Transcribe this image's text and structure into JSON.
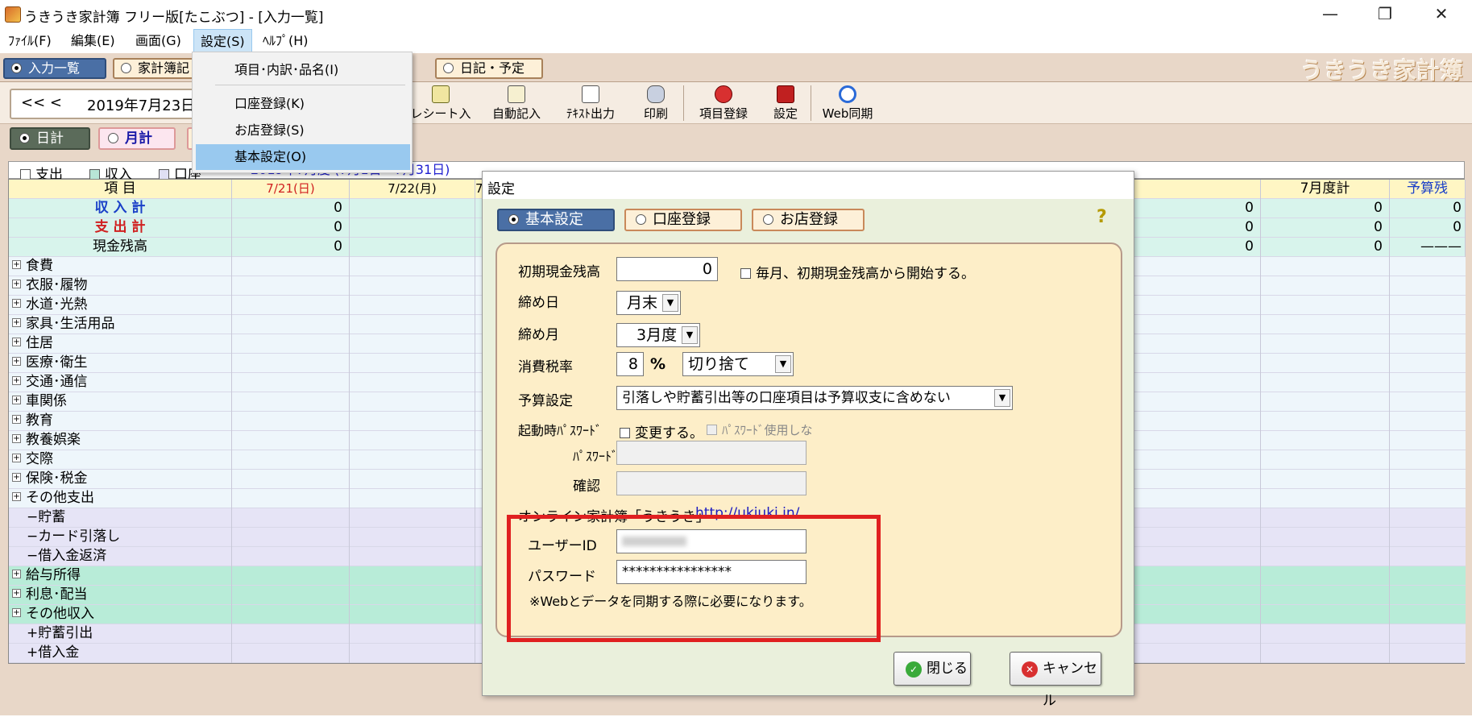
{
  "window": {
    "title": "うきうき家計簿 フリー版[たこぶつ] - [入力一覧]",
    "controls": {
      "minimize": "—",
      "maximize": "❐",
      "close": "✕"
    }
  },
  "menubar": [
    "ﾌｧｲﾙ(F)",
    "編集(E)",
    "画面(G)",
    "設定(S)",
    "ﾍﾙﾌﾟ(H)"
  ],
  "settings_menu": {
    "items": [
      "項目･内訳･品名(I)",
      "口座登録(K)",
      "お店登録(S)",
      "基本設定(O)"
    ],
    "highlighted": "基本設定(O)"
  },
  "tabs": [
    "入力一覧",
    "家計簿記",
    "日記・予定"
  ],
  "logo": "うきうき家計簿",
  "toolbar": {
    "date_nav": "<<  <",
    "date": "2019年7月23日",
    "buttons": [
      "レシート入力",
      "自動記入",
      "ﾃｷｽﾄ出力",
      "印刷",
      "項目登録",
      "設定",
      "Web同期"
    ]
  },
  "view": {
    "daily": "日計",
    "monthly": "月計"
  },
  "filters": [
    "支出",
    "収入",
    "口座"
  ],
  "filter_period": "2019年7月度 (7月1日〜7月31日)",
  "grid": {
    "headers": [
      "項 目",
      "7/21(日)",
      "7/22(月)",
      "7/2",
      "7月度計",
      "予算残"
    ],
    "summary_rows": [
      {
        "label": "収 入 計",
        "v1": "0",
        "r1": "0",
        "r2": "0",
        "r3": "0"
      },
      {
        "label": "支 出 計",
        "v1": "0",
        "r1": "0",
        "r2": "0",
        "r3": "0"
      },
      {
        "label": "現金残高",
        "v1": "0",
        "r1": "0",
        "r2": "0",
        "r3": "———"
      }
    ],
    "expense_items": [
      "食費",
      "衣服･履物",
      "水道･光熱",
      "家具･生活用品",
      "住居",
      "医療･衛生",
      "交通･通信",
      "車関係",
      "教育",
      "教養娯楽",
      "交際",
      "保険･税金",
      "その他支出"
    ],
    "transfer_out": [
      "−貯蓄",
      "−カード引落し",
      "−借入金返済"
    ],
    "income_items": [
      "給与所得",
      "利息･配当",
      "その他収入"
    ],
    "transfer_in": [
      "+貯蓄引出",
      "+借入金"
    ],
    "expand_icon": "+"
  },
  "dialog": {
    "title": "設定",
    "tabs": [
      "基本設定",
      "口座登録",
      "お店登録"
    ],
    "help_icon": "?",
    "fields": {
      "initial_cash_label": "初期現金残高",
      "initial_cash_value": "0",
      "monthly_reset_label": "毎月、初期現金残高から開始する。",
      "closing_day_label": "締め日",
      "closing_day_value": "月末",
      "closing_month_label": "締め月",
      "closing_month_value": "3月度",
      "tax_rate_label": "消費税率",
      "tax_rate_value": "8",
      "tax_unit": "%",
      "rounding_value": "切り捨て",
      "budget_label": "予算設定",
      "budget_value": "引落しや貯蓄引出等の口座項目は予算収支に含めない",
      "startup_password_label": "起動時ﾊﾟｽﾜｰﾄﾞ",
      "change_label": "変更する。",
      "no_password_label": "ﾊﾟｽﾜｰﾄﾞ使用しな",
      "password_label": "ﾊﾟｽﾜｰﾄﾞ",
      "confirm_label": "確認"
    },
    "online": {
      "title": "オンライン家計簿「うきうき」",
      "link": "http://ukiuki.in/",
      "user_id_label": "ユーザーID",
      "password_label": "パスワード",
      "password_value": "****************",
      "note": "※Webとデータを同期する際に必要になります。"
    },
    "buttons": {
      "close": "閉じる",
      "cancel": "キャンセル"
    }
  }
}
